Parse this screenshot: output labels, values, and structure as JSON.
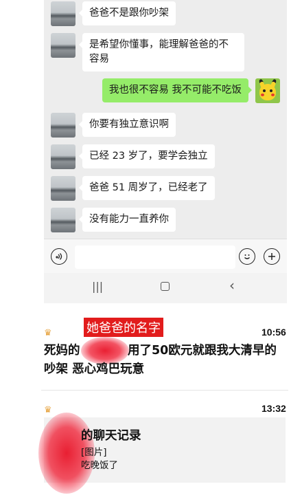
{
  "chat": {
    "messages": [
      {
        "side": "left",
        "text": "爸爸不是跟你吵架"
      },
      {
        "side": "left",
        "text": "是希望你懂事，能理解爸爸的不容易"
      },
      {
        "side": "right",
        "text": "我也很不容易 我不可能不吃饭"
      },
      {
        "side": "left",
        "text": "你要有独立意识啊"
      },
      {
        "side": "left",
        "text": "已经 23 岁了，要学会独立"
      },
      {
        "side": "left",
        "text": "爸爸 51 周岁了，已经老了"
      },
      {
        "side": "left",
        "text": "没有能力一直养你"
      }
    ],
    "input": {
      "value": "",
      "voice_icon": "voice-icon",
      "emoji_icon": "emoji-icon",
      "plus_icon": "plus-icon"
    },
    "nav": {
      "recent": "|||",
      "home": "○",
      "back": "‹"
    }
  },
  "posts": [
    {
      "badge": "crown-icon",
      "annotation": "她爸爸的名字",
      "time": "10:56",
      "text_part1": "死妈的",
      "text_part2": "用了50欧元就跟我大清早的吵架 恶心鸡巴玩意"
    },
    {
      "badge": "crown-icon",
      "time": "13:32",
      "card": {
        "title": "的聊天记录",
        "lines": [
          "[图片]",
          "吃晚饭了"
        ]
      }
    }
  ],
  "colors": {
    "accent_red": "#e21c1c",
    "wechat_green": "#95ec69",
    "badge_gold": "#e6a23c"
  }
}
